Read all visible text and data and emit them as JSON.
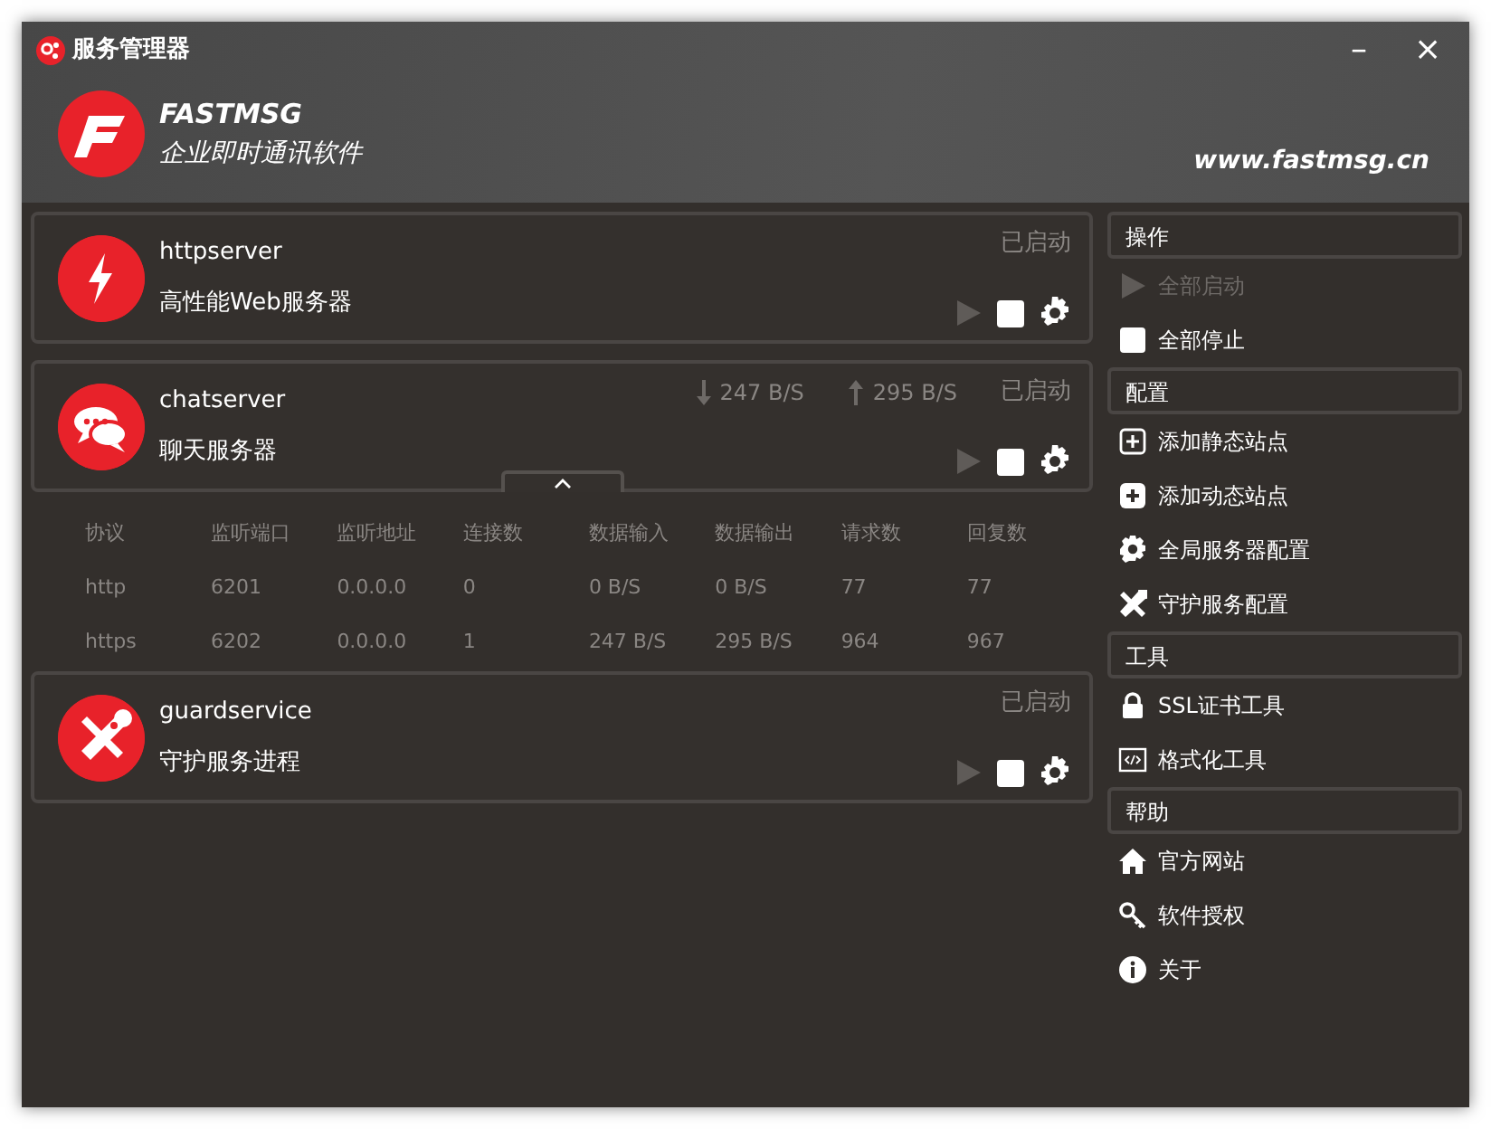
{
  "window": {
    "title": "服务管理器",
    "buttons": [
      "–",
      "×"
    ]
  },
  "header": {
    "brand": "FASTMSG",
    "tagline": "企业即时通讯软件",
    "website": "www.fastmsg.cn"
  },
  "services": [
    {
      "name": "httpserver",
      "description": "高性能Web服务器",
      "status": "已启动",
      "running": true
    },
    {
      "name": "chatserver",
      "description": "聊天服务器",
      "status": "已启动",
      "running": true,
      "expanded": true,
      "download": "247 B/S",
      "upload": "295 B/S",
      "table": {
        "columns": [
          "协议",
          "监听端口",
          "监听地址",
          "连接数",
          "数据输入",
          "数据输出",
          "请求数",
          "回复数"
        ],
        "rows": [
          [
            "http",
            "6201",
            "0.0.0.0",
            "0",
            "0 B/S",
            "0 B/S",
            "77",
            "77"
          ],
          [
            "https",
            "6202",
            "0.0.0.0",
            "1",
            "247 B/S",
            "295 B/S",
            "964",
            "967"
          ]
        ]
      }
    },
    {
      "name": "guardservice",
      "description": "守护服务进程",
      "status": "已启动",
      "running": true
    }
  ],
  "sidebar": [
    {
      "title": "操作",
      "items": [
        {
          "label": "全部启动",
          "disabled": true
        },
        {
          "label": "全部停止",
          "disabled": false
        }
      ]
    },
    {
      "title": "配置",
      "items": [
        {
          "label": "添加静态站点",
          "disabled": false
        },
        {
          "label": "添加动态站点",
          "disabled": false
        },
        {
          "label": "全局服务器配置",
          "disabled": false
        },
        {
          "label": "守护服务配置",
          "disabled": false
        }
      ]
    },
    {
      "title": "工具",
      "items": [
        {
          "label": "SSL证书工具",
          "disabled": false
        },
        {
          "label": "格式化工具",
          "disabled": false
        }
      ]
    },
    {
      "title": "帮助",
      "items": [
        {
          "label": "官方网站",
          "disabled": false
        },
        {
          "label": "软件授权",
          "disabled": false
        },
        {
          "label": "关于",
          "disabled": false
        }
      ]
    }
  ]
}
